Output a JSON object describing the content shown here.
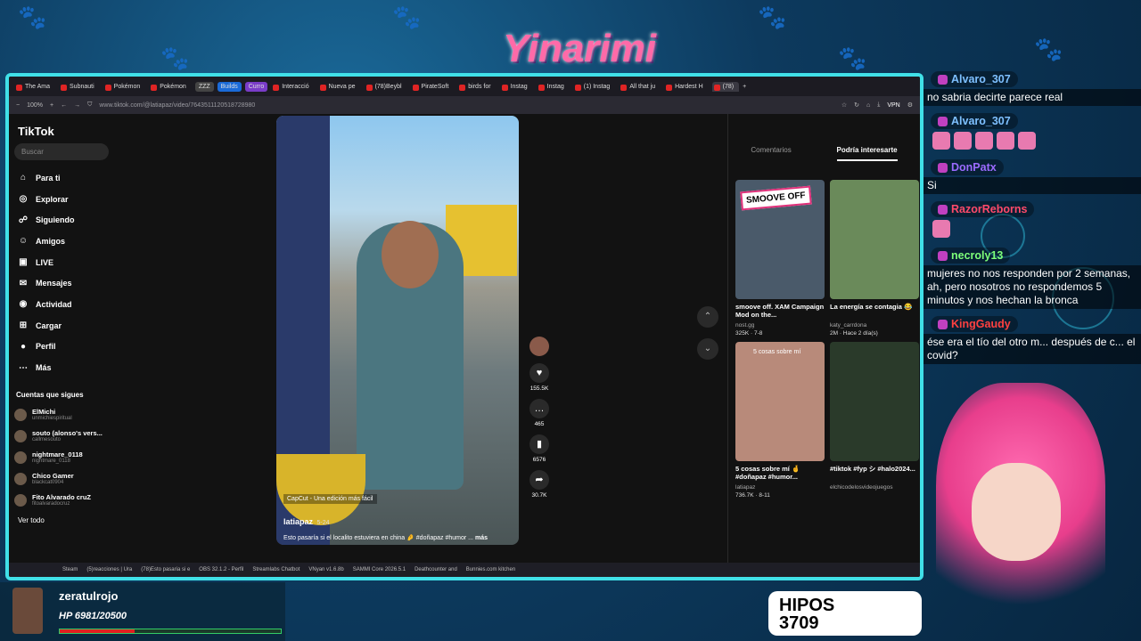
{
  "browser": {
    "tabs": [
      "The Ama",
      "Subnauti",
      "Pokémon",
      "Pokémon",
      "ZZZ",
      "Builds",
      "Curro",
      "Interacció",
      "Nueva pe",
      "(78)Beybl",
      "PirateSoft",
      "birds for ",
      "Instag",
      "Instag",
      "(1) Instag",
      "All that ju",
      "Hardest H",
      "(78)"
    ],
    "zoom": "100%",
    "url": "www.tiktok.com/@latiapaz/video/7643511120518728980",
    "vpn": "VPN"
  },
  "tiktok": {
    "logo": "TikTok",
    "search_placeholder": "Buscar",
    "nav": [
      {
        "label": "Para ti",
        "icon": "home-icon"
      },
      {
        "label": "Explorar",
        "icon": "compass-icon"
      },
      {
        "label": "Siguiendo",
        "icon": "following-icon"
      },
      {
        "label": "Amigos",
        "icon": "friends-icon"
      },
      {
        "label": "LIVE",
        "icon": "live-icon"
      },
      {
        "label": "Mensajes",
        "icon": "message-icon"
      },
      {
        "label": "Actividad",
        "icon": "activity-icon"
      },
      {
        "label": "Cargar",
        "icon": "upload-icon"
      },
      {
        "label": "Perfil",
        "icon": "profile-icon"
      },
      {
        "label": "Más",
        "icon": "more-icon"
      }
    ],
    "following_title": "Cuentas que sigues",
    "following": [
      {
        "name": "ElMichi",
        "handle": "unmichiespiritual"
      },
      {
        "name": "souto (alonso's vers...",
        "handle": "callmesouto"
      },
      {
        "name": "nightmare_0118",
        "handle": "nightmare_0118"
      },
      {
        "name": "Chico Gamer",
        "handle": "blackcat0904"
      },
      {
        "name": "Fito Alvarado cruZ",
        "handle": "fitoalvaradocruz"
      }
    ],
    "see_all": "Ver todo",
    "video": {
      "capcut": "CapCut - Una edición más fácil",
      "author": "latiapaz",
      "date": "5-24",
      "description": "Esto pasaría si el localito estuviera en china 🤌 #doñapaz #humor ...",
      "more": "más"
    },
    "actions": {
      "likes": "155.5K",
      "comments": "465",
      "saves": "6576",
      "shares": "30.7K"
    },
    "right_tabs": [
      "Comentarios",
      "Podría interesarte"
    ],
    "suggestions": [
      {
        "title": "smoove off. XAM Campaign Mod on the...",
        "author": "nost.gg",
        "stats": "325K · 7-8",
        "overlay": "SMOOVE OFF"
      },
      {
        "title": "La energía se contagia 😂",
        "author": "katy_carrdona",
        "stats": "2M · Hace 2 día(s)"
      },
      {
        "title": "5 cosas sobre mí 🤞 #doñapaz #humor...",
        "author": "latiapaz",
        "stats": "736.7K · 8-11",
        "overlay": "5 cosas sobre mí"
      },
      {
        "title": "#tiktok #fyp シ #halo2024...",
        "author": "elchicodelosvideojuegos",
        "stats": "",
        "overlay": ""
      }
    ]
  },
  "taskbar": [
    "Steam",
    "(5)reacciones | Ura",
    "(78)Esto pasaria si e",
    "OBS 32.1.2 - Perfil",
    "Streamlabs Chatbot",
    "VNyan v1.6.8b",
    "SAMMI Core 2026.5.1",
    "Deathcounter and",
    "Bunnies.com kitchen"
  ],
  "chat": [
    {
      "user": "Alvaro_307",
      "color": "#7ec0ff",
      "text": "no sabria decirte parece real",
      "emotes": 0
    },
    {
      "user": "Alvaro_307",
      "color": "#7ec0ff",
      "text": "",
      "emotes": 5
    },
    {
      "user": "DonPatx",
      "color": "#9b6bff",
      "text": "Si",
      "emotes": 0
    },
    {
      "user": "RazorReborns",
      "color": "#ff4a6a",
      "text": "",
      "emotes": 1
    },
    {
      "user": "necroly13",
      "color": "#7dff7a",
      "text": "mujeres no nos responden por 2 semanas, ah, pero nosotros no respondemos 5 minutos y nos hechan la bronca",
      "emotes": 0
    },
    {
      "user": "KingGaudy",
      "color": "#ff4040",
      "text": "ése era el tío del otro m... después de c... el covid?",
      "emotes": 0
    }
  ],
  "overlay": {
    "title": "Yinarimi",
    "player": "zeratulrojo",
    "hp_label": "HP 6981/20500",
    "hp_fraction": 0.34,
    "counter_label": "HIPOS",
    "counter_value": "3709"
  }
}
